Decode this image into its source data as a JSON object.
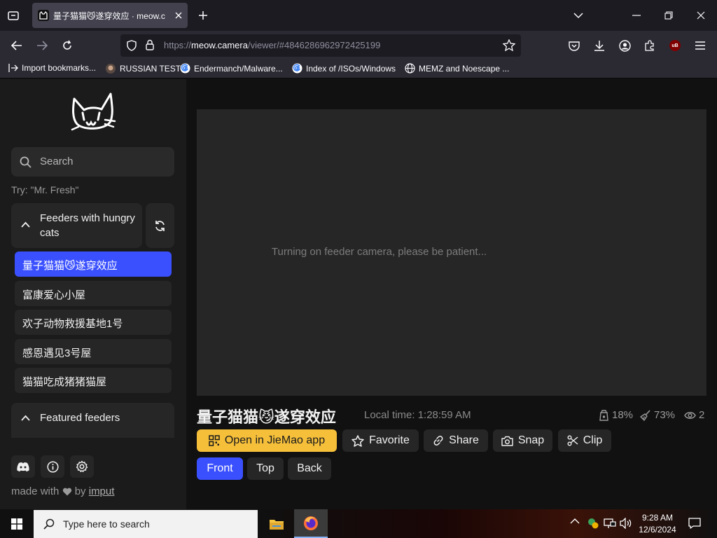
{
  "browser": {
    "tab_title": "量子猫猫😼遂穿效应 · meow.c",
    "url_prefix": "https://",
    "url_host": "meow.camera",
    "url_path": "/viewer/#4846286962972425199",
    "extension_badge": "uB",
    "bookmarks": [
      "Import bookmarks...",
      "RUSSIAN TEST",
      "Endermanch/Malware...",
      "Index of /ISOs/Windows",
      "MEMZ and Noescape ..."
    ]
  },
  "sidebar": {
    "search_placeholder": "Search",
    "try_hint": "Try: \"Mr. Fresh\"",
    "group_hungry": "Feeders with hungry cats",
    "feeders": [
      "量子猫猫😼遂穿效应",
      "富康爱心小屋",
      "欢子动物救援基地1号",
      "感恩遇见3号屋",
      "猫猫吃成猪猪猫屋"
    ],
    "group_featured": "Featured feeders",
    "made_with": "made with",
    "by": "by",
    "author": "imput"
  },
  "viewer": {
    "status_message": "Turning on feeder camera, please be patient...",
    "camera_name": "量子猫猫😼遂穿效应",
    "local_time": "Local time: 1:28:59 AM",
    "food_level": "18%",
    "cleanliness": "73%",
    "viewers": "2",
    "buttons": {
      "open_app": "Open in JieMao app",
      "favorite": "Favorite",
      "share": "Share",
      "snap": "Snap",
      "clip": "Clip"
    },
    "camera_views": [
      "Front",
      "Top",
      "Back"
    ],
    "active_view": "Front"
  },
  "taskbar": {
    "search_placeholder": "Type here to search",
    "time": "9:28 AM",
    "date": "12/6/2024"
  },
  "colors": {
    "accent_blue": "#3a50ff",
    "app_button_yellow": "#f5bf3a"
  }
}
